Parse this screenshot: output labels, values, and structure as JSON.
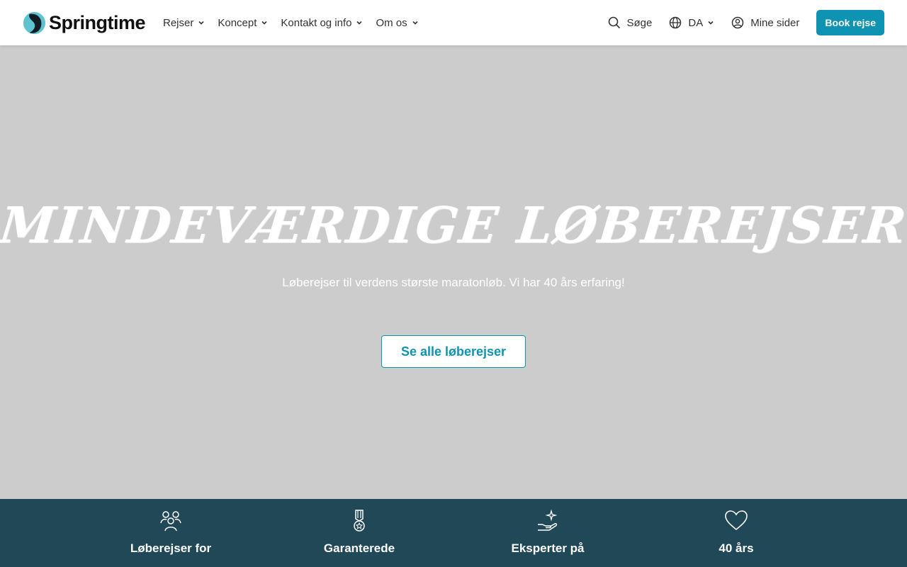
{
  "header": {
    "logo_text": "Springtime",
    "nav": [
      {
        "label": "Rejser"
      },
      {
        "label": "Koncept"
      },
      {
        "label": "Kontakt og info"
      },
      {
        "label": "Om os"
      }
    ],
    "search_label": "Søge",
    "language_label": "DA",
    "account_label": "Mine sider",
    "book_label": "Book rejse"
  },
  "hero": {
    "title": "Mindeværdige Løberejser",
    "subtitle": "Løberejser til verdens største maratonløb. Vi har 40 års erfaring!",
    "cta_label": "Se alle løberejser"
  },
  "features": [
    {
      "label": "Løberejser for",
      "icon": "people-icon"
    },
    {
      "label": "Garanterede",
      "icon": "medal-icon"
    },
    {
      "label": "Eksperter på",
      "icon": "hand-sparkle-icon"
    },
    {
      "label": "40 års",
      "icon": "heart-icon"
    }
  ],
  "colors": {
    "accent": "#0f93b3",
    "band": "#214857"
  }
}
